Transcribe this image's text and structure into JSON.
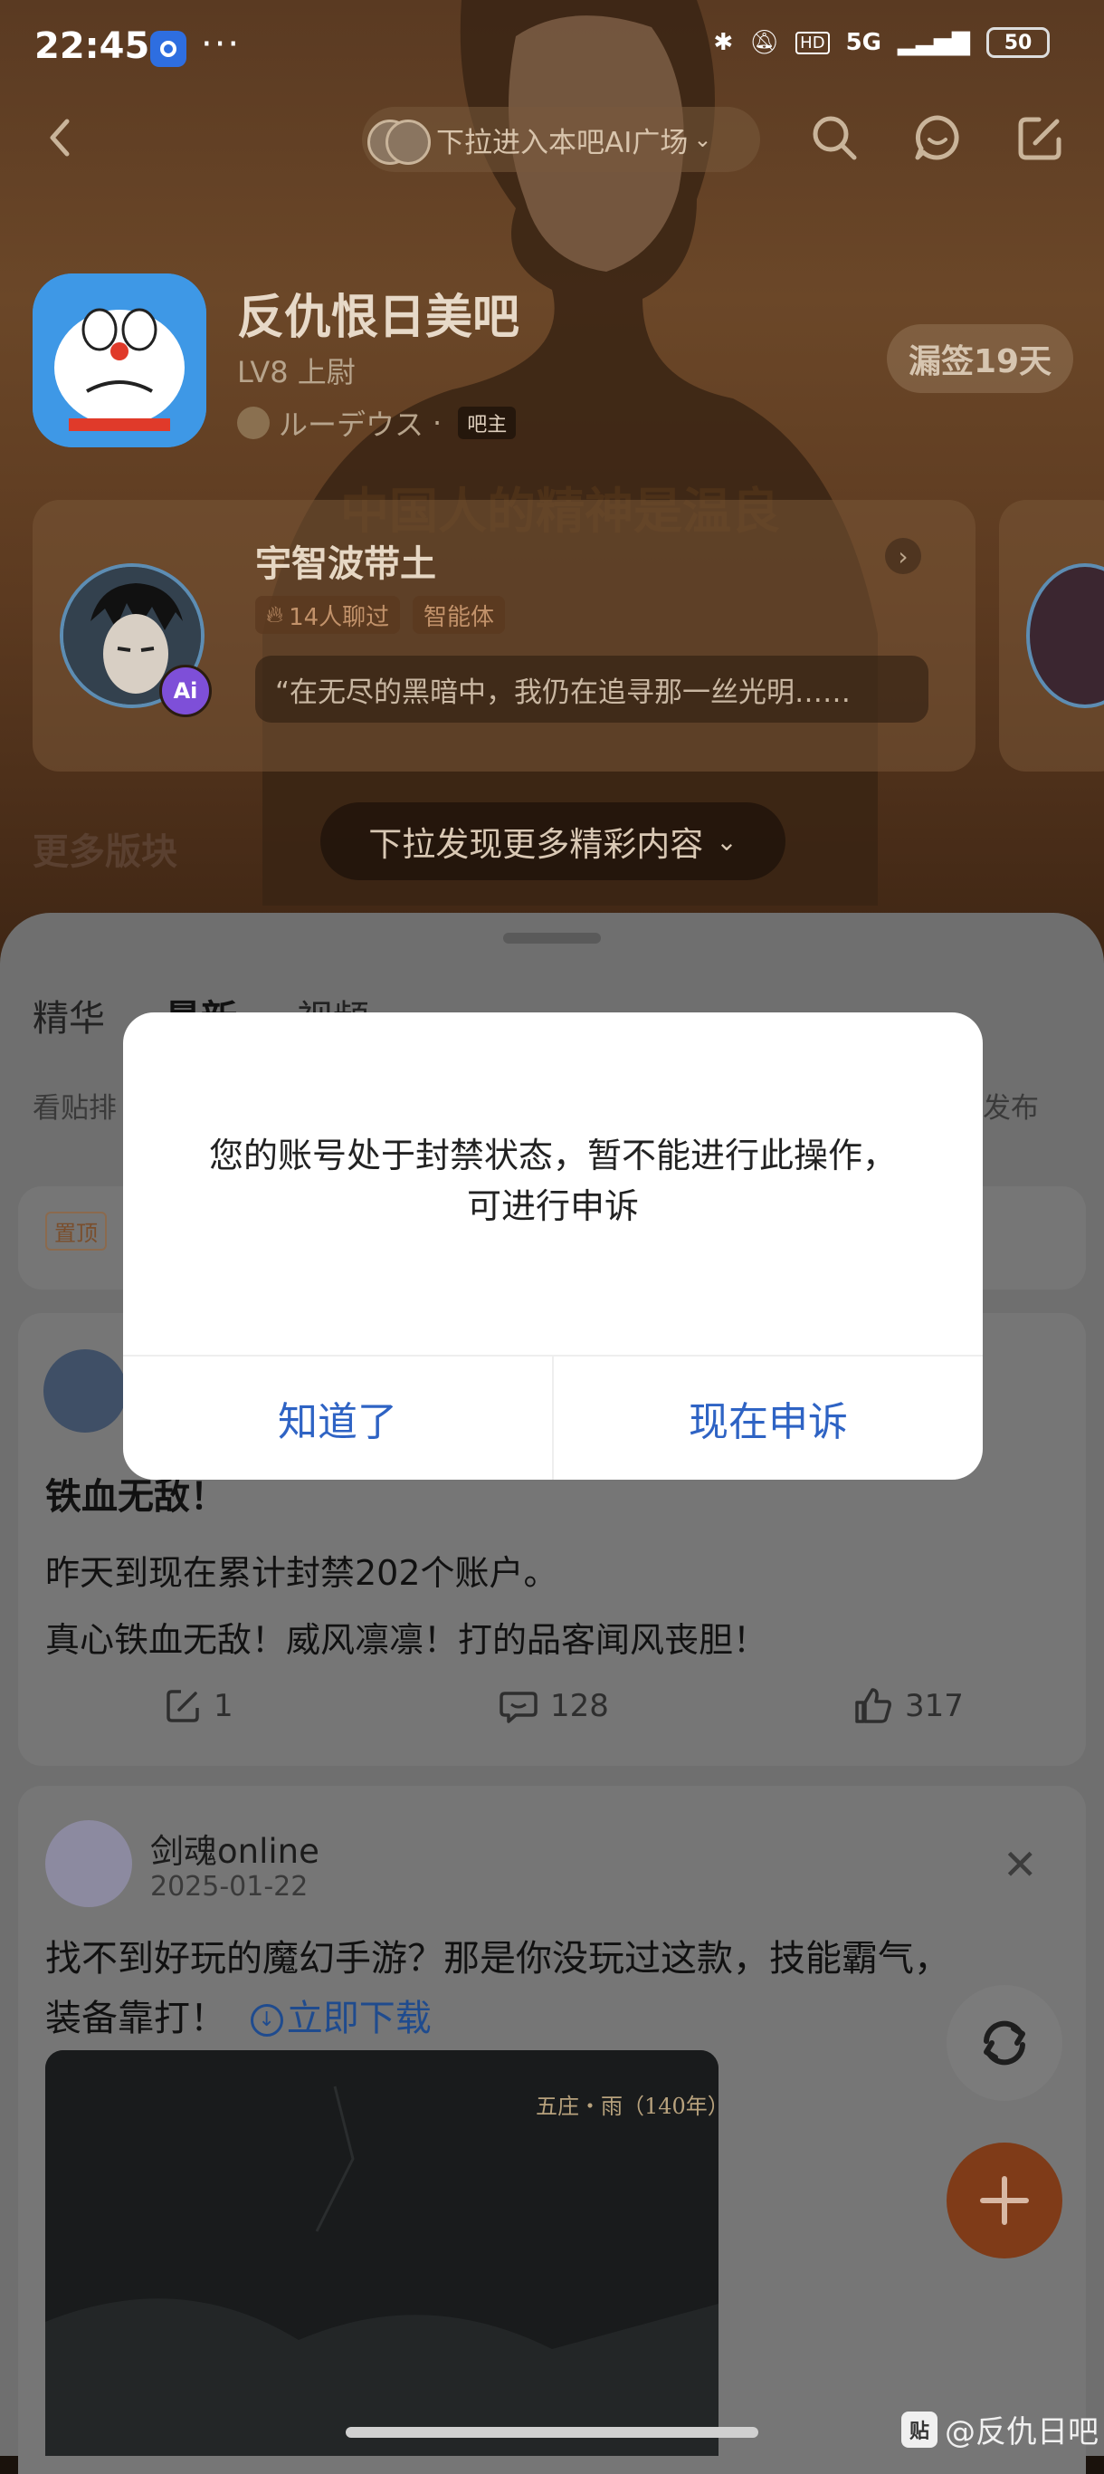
{
  "status_bar": {
    "time": "22:45",
    "dots": "···",
    "network": "5G",
    "hd": "HD",
    "battery": "50"
  },
  "top_nav": {
    "pill_label": "下拉进入本吧AI广场"
  },
  "forum": {
    "title": "反仇恨日美吧",
    "level": "LV8 上尉",
    "owner_name": "ルーデウス",
    "owner_tag": "吧主",
    "sign_button": "漏签19天",
    "photo_caption": "中国人的精神是温良"
  },
  "ai_card": {
    "badge": "Ai",
    "name": "宇智波带土",
    "chat_count": "14人聊过",
    "type_tag": "智能体",
    "quote": "“在无尽的黑暗中，我仍在追寻那一丝光明……"
  },
  "more_sections": "更多版块",
  "pull_hint": "下拉发现更多精彩内容",
  "tabs": [
    "精华",
    "最新",
    "视频"
  ],
  "subrow": {
    "left": "看贴排",
    "right": "发布"
  },
  "pinned": {
    "tag": "置顶"
  },
  "post": {
    "title": "铁血无敌！",
    "line1": "昨天到现在累计封禁202个账户。",
    "line2": "真心铁血无敌！威风凛凛！打的品客闻风丧胆！",
    "shares": "1",
    "comments": "128",
    "likes": "317"
  },
  "ad": {
    "name": "剑魂online",
    "date": "2025-01-22",
    "text_line1": "找不到好玩的魔幻手游？那是你没玩过这款，技能霸气，",
    "text_line2": "装备靠打！",
    "link": "立即下载",
    "image_label": "五庄・雨（140年）"
  },
  "dialog": {
    "message_line1": "您的账号处于封禁状态，暂不能进行此操作，",
    "message_line2": "可进行申诉",
    "ok_button": "知道了",
    "appeal_button": "现在申诉"
  },
  "watermark": {
    "logo": "贴",
    "text": "@反仇日吧"
  },
  "colors": {
    "accent": "#2e63c4",
    "fab": "#7f3b18"
  }
}
